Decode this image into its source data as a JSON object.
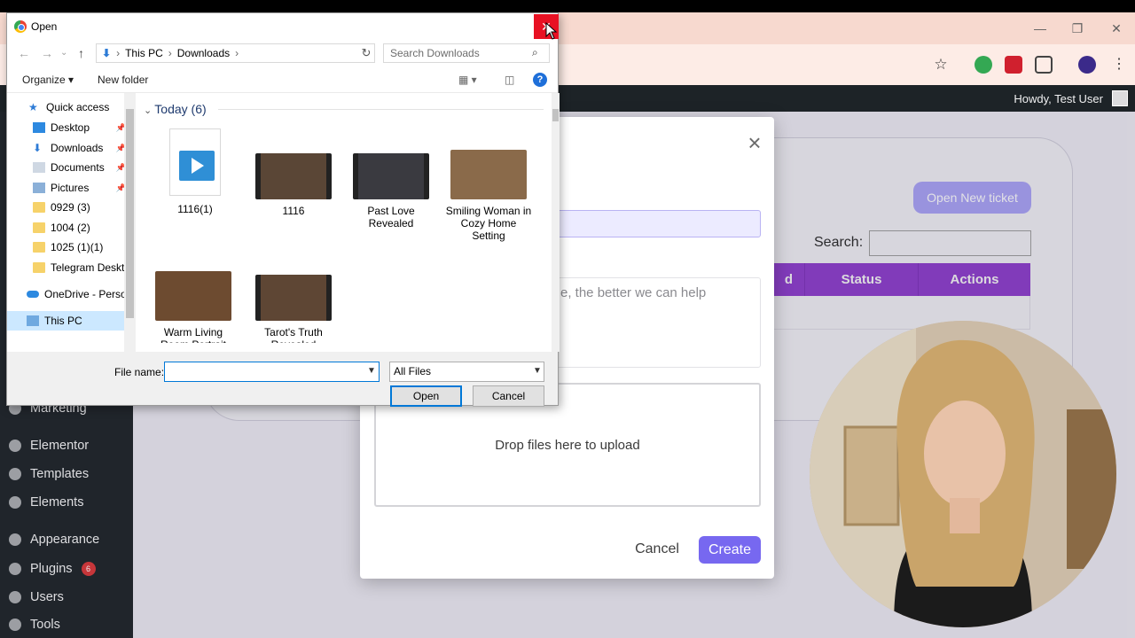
{
  "browser": {
    "window_controls": {
      "minimize": "—",
      "restore": "❐",
      "close": "✕"
    },
    "toolbar_icons": [
      "star-icon",
      "extension-green-icon",
      "extension-red-icon",
      "puzzle-icon",
      "profile-avatar-icon",
      "more-menu-icon"
    ]
  },
  "wp_adminbar": {
    "greeting": "Howdy, Test User"
  },
  "wp_sidebar": {
    "items": [
      {
        "label": "Marketing",
        "icon": "megaphone-icon"
      },
      {
        "label": "Elementor",
        "icon": "elementor-icon"
      },
      {
        "label": "Templates",
        "icon": "folder-icon"
      },
      {
        "label": "Elements",
        "icon": "bolt-icon"
      },
      {
        "label": "Appearance",
        "icon": "brush-icon"
      },
      {
        "label": "Plugins",
        "icon": "plug-icon",
        "badge": "6"
      },
      {
        "label": "Users",
        "icon": "user-icon"
      },
      {
        "label": "Tools",
        "icon": "wrench-icon"
      }
    ]
  },
  "tickets_page": {
    "open_ticket_button": "Open New ticket",
    "search_label": "Search:",
    "table_headers": [
      "d",
      "Status",
      "Actions"
    ]
  },
  "modal": {
    "close_glyph": "×",
    "textarea_placeholder_visible": "e, the better we can help",
    "dropzone_text": "Drop files here to upload",
    "cancel_label": "Cancel",
    "create_label": "Create",
    "accent_color": "#7768f0"
  },
  "dialog": {
    "title": "Open",
    "close_glyph": "✕",
    "breadcrumb": [
      "This PC",
      "Downloads"
    ],
    "search_placeholder": "Search Downloads",
    "organize_label": "Organize",
    "new_folder_label": "New folder",
    "help_glyph": "?",
    "nav_items": [
      {
        "label": "Quick access",
        "icon": "star-icon",
        "pinned": false
      },
      {
        "label": "Desktop",
        "icon": "desktop-icon",
        "pinned": true
      },
      {
        "label": "Downloads",
        "icon": "download-icon",
        "pinned": true
      },
      {
        "label": "Documents",
        "icon": "document-icon",
        "pinned": true
      },
      {
        "label": "Pictures",
        "icon": "pictures-icon",
        "pinned": true
      },
      {
        "label": "0929 (3)",
        "icon": "folder-icon",
        "pinned": false
      },
      {
        "label": "1004 (2)",
        "icon": "folder-icon",
        "pinned": false
      },
      {
        "label": "1025 (1)(1)",
        "icon": "folder-icon",
        "pinned": false
      },
      {
        "label": "Telegram Deskto",
        "icon": "folder-icon",
        "pinned": false
      },
      {
        "label": "OneDrive - Persor",
        "icon": "cloud-icon",
        "pinned": false
      },
      {
        "label": "This PC",
        "icon": "computer-icon",
        "pinned": false
      }
    ],
    "group_header": "Today (6)",
    "files": [
      {
        "name": "1116(1)",
        "kind": "video-file-icon"
      },
      {
        "name": "1116",
        "kind": "video-thumbnail"
      },
      {
        "name": "Past Love Revealed",
        "kind": "video-thumbnail"
      },
      {
        "name": "Smiling Woman in Cozy Home Setting",
        "kind": "photo-thumbnail"
      },
      {
        "name": "Warm Living Room Portrait",
        "kind": "photo-thumbnail"
      },
      {
        "name": "Tarot's Truth Revealed",
        "kind": "video-thumbnail"
      }
    ],
    "file_name_label": "File name:",
    "file_name_value": "",
    "file_type_value": "All Files",
    "open_label": "Open",
    "cancel_label": "Cancel"
  }
}
